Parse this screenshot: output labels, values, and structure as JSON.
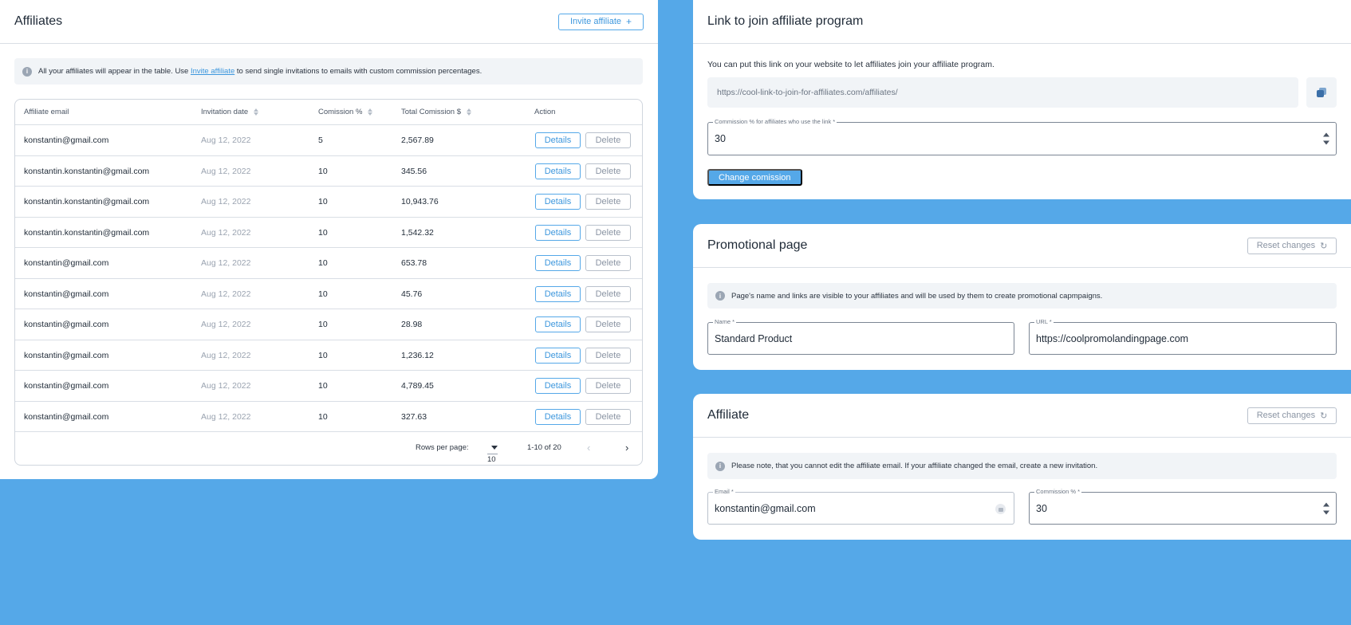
{
  "affiliates": {
    "title": "Affiliates",
    "invite_label": "Invite affiliate",
    "invite_icon": "plus-icon",
    "info": {
      "before": "All your affiliates will appear in the table. Use",
      "link": "Invite affiliate",
      "after": "to send single invitations to emails with custom commission percentages."
    },
    "columns": [
      "Affiliate email",
      "Invitation date",
      "Comission %",
      "Total Comission $",
      "Action"
    ],
    "details_label": "Details",
    "delete_label": "Delete",
    "rows": [
      {
        "email": "konstantin@gmail.com",
        "date": "Aug 12, 2022",
        "commission": "5",
        "total": "2,567.89"
      },
      {
        "email": "konstantin.konstantin@gmail.com",
        "date": "Aug 12, 2022",
        "commission": "10",
        "total": "345.56"
      },
      {
        "email": "konstantin.konstantin@gmail.com",
        "date": "Aug 12, 2022",
        "commission": "10",
        "total": "10,943.76"
      },
      {
        "email": "konstantin.konstantin@gmail.com",
        "date": "Aug 12, 2022",
        "commission": "10",
        "total": "1,542.32"
      },
      {
        "email": "konstantin@gmail.com",
        "date": "Aug 12, 2022",
        "commission": "10",
        "total": "653.78"
      },
      {
        "email": "konstantin@gmail.com",
        "date": "Aug 12, 2022",
        "commission": "10",
        "total": "45.76"
      },
      {
        "email": "konstantin@gmail.com",
        "date": "Aug 12, 2022",
        "commission": "10",
        "total": "28.98"
      },
      {
        "email": "konstantin@gmail.com",
        "date": "Aug 12, 2022",
        "commission": "10",
        "total": "1,236.12"
      },
      {
        "email": "konstantin@gmail.com",
        "date": "Aug 12, 2022",
        "commission": "10",
        "total": "4,789.45"
      },
      {
        "email": "konstantin@gmail.com",
        "date": "Aug 12, 2022",
        "commission": "10",
        "total": "327.63"
      }
    ],
    "pagination": {
      "rows_per_page_label": "Rows per page:",
      "rows_per_page_value": "10",
      "range": "1-10 of 20"
    }
  },
  "join_link": {
    "title": "Link to join affiliate program",
    "description": "You can put this link on your website to let affiliates join your affiliate program.",
    "url": "https://cool-link-to-join-for-affiliates.com/affiliates/",
    "commission_label": "Commission % for affiliates who use the link *",
    "commission_value": "30",
    "change_label": "Change comission"
  },
  "promo": {
    "title": "Promotional page",
    "reset_label": "Reset changes",
    "info": "Page's name and links are visible to your affiliates and will be used by them to create promotional capmpaigns.",
    "name_label": "Name *",
    "name_value": "Standard Product",
    "url_label": "URL *",
    "url_value": "https://coolpromolandingpage.com"
  },
  "affiliate": {
    "title": "Affiliate",
    "reset_label": "Reset changes",
    "info": "Please note, that you cannot edit the affiliate email. If your affiliate changed the email, create a new invitation.",
    "email_label": "Email *",
    "email_value": "konstantin@gmail.com",
    "commission_label": "Commission % *",
    "commission_value": "30"
  },
  "colors": {
    "background": "#55a8e8",
    "accent": "#3d97dd",
    "muted": "#9aa3b0"
  }
}
